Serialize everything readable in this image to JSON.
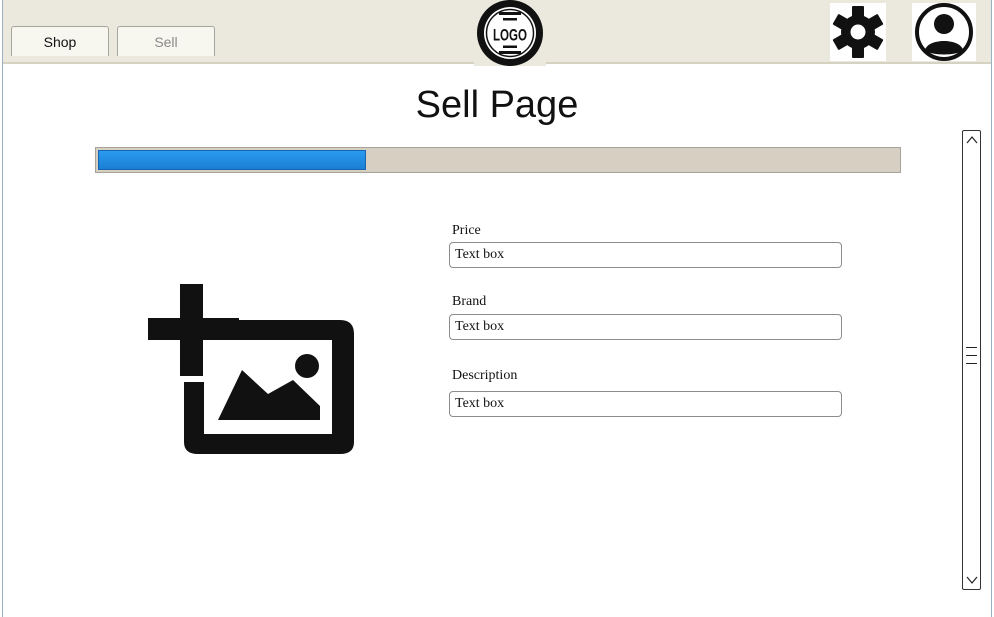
{
  "tabs": [
    {
      "label": "Shop"
    },
    {
      "label": "Sell"
    }
  ],
  "header": {
    "logo_text": "LOGO",
    "settings_icon": "gear-icon",
    "profile_icon": "user-circle-icon"
  },
  "page": {
    "title": "Sell Page",
    "progress_fraction": 0.335
  },
  "form": {
    "fields": [
      {
        "label": "Price",
        "value": "Text box"
      },
      {
        "label": "Brand",
        "value": "Text box"
      },
      {
        "label": "Description",
        "value": "Text box"
      }
    ]
  },
  "colors": {
    "topbar": "#ebe9de",
    "progress_track": "#d8cfc3",
    "progress_fill": "#1a7fd4"
  }
}
